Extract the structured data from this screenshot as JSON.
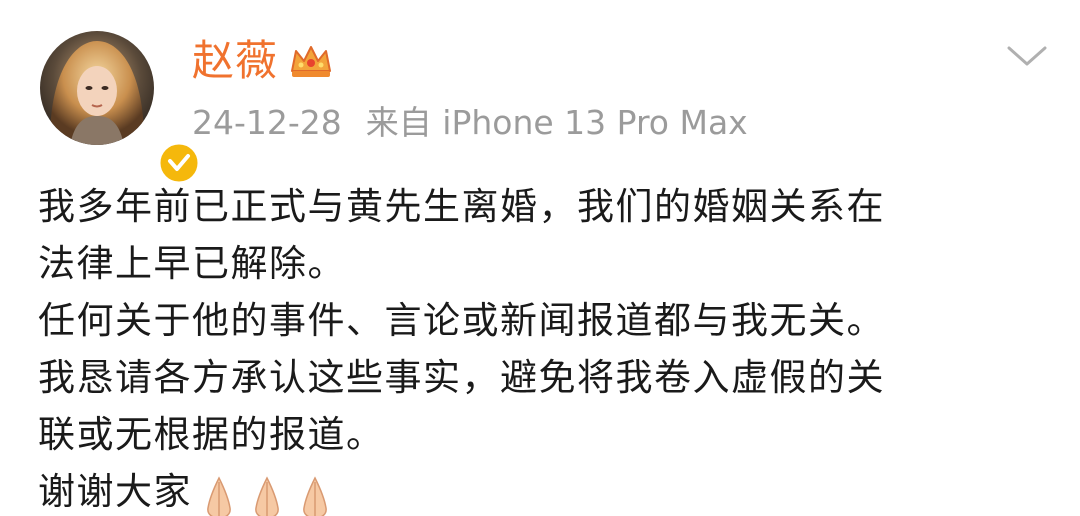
{
  "post": {
    "username": "赵薇",
    "date": "24-12-28",
    "source": "来自 iPhone 13 Pro Max",
    "lines": [
      "我多年前已正式与黄先生离婚，我们的婚姻关系在",
      "法律上早已解除。",
      "任何关于他的事件、言论或新闻报道都与我无关。",
      "我恳请各方承认这些事实，避免将我卷入虚假的关",
      "联或无根据的报道。"
    ],
    "thanks": "谢谢大家",
    "thanks_emoji": [
      "folded-hands-icon",
      "folded-hands-icon",
      "folded-hands-icon"
    ]
  },
  "colors": {
    "username": "#f0722e",
    "meta": "#9b9b9b",
    "body": "#1a1a1a",
    "verified_badge": "#f5b80c"
  },
  "icons": {
    "avatar": "avatar",
    "verified": "verified-badge-icon",
    "crown": "crown-icon",
    "menu": "chevron-down-icon"
  }
}
